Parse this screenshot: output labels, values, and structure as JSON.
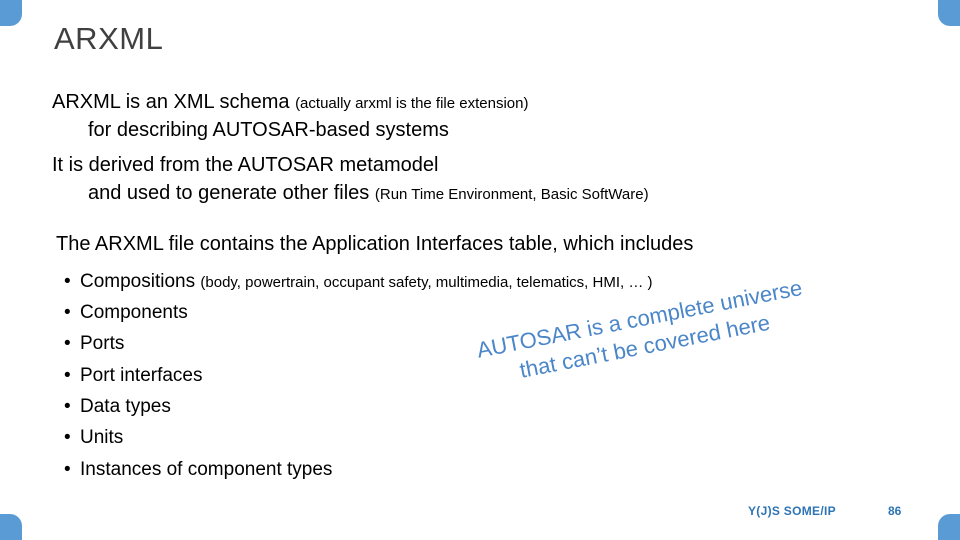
{
  "slide": {
    "title": "ARXML",
    "accent_color": "#5b9bd5",
    "title_color": "#404040",
    "body": {
      "para1_lead": "ARXML is an XML schema",
      "para1_paren": "(actually arxml is the file extension)",
      "para1_cont": "for describing AUTOSAR-based systems",
      "para2_lead": "It is derived from the AUTOSAR metamodel",
      "para2_cont": "and used to generate other files",
      "para2_paren": "(Run Time Environment, Basic SoftWare)",
      "para3": "The ARXML file contains the Application Interfaces table, which includes",
      "bullets": [
        {
          "marker": "•",
          "label": "Compositions",
          "note": "(body, powertrain, occupant safety, multimedia, telematics, HMI, … )"
        },
        {
          "marker": "•",
          "label": "Components",
          "note": ""
        },
        {
          "marker": "•",
          "label": "Ports",
          "note": ""
        },
        {
          "marker": "•",
          "label": "Port interfaces",
          "note": ""
        },
        {
          "marker": "•",
          "label": "Data types",
          "note": ""
        },
        {
          "marker": "•",
          "label": "Units",
          "note": ""
        },
        {
          "marker": "•",
          "label": "Instances of component types",
          "note": ""
        }
      ]
    },
    "stamp": {
      "line1": "AUTOSAR is a complete universe",
      "line2": "that can’t be covered here",
      "color": "#4a86c8"
    },
    "footer": {
      "label": "Y(J)S  SOME/IP",
      "page": "86",
      "color": "#2e74b5"
    }
  }
}
